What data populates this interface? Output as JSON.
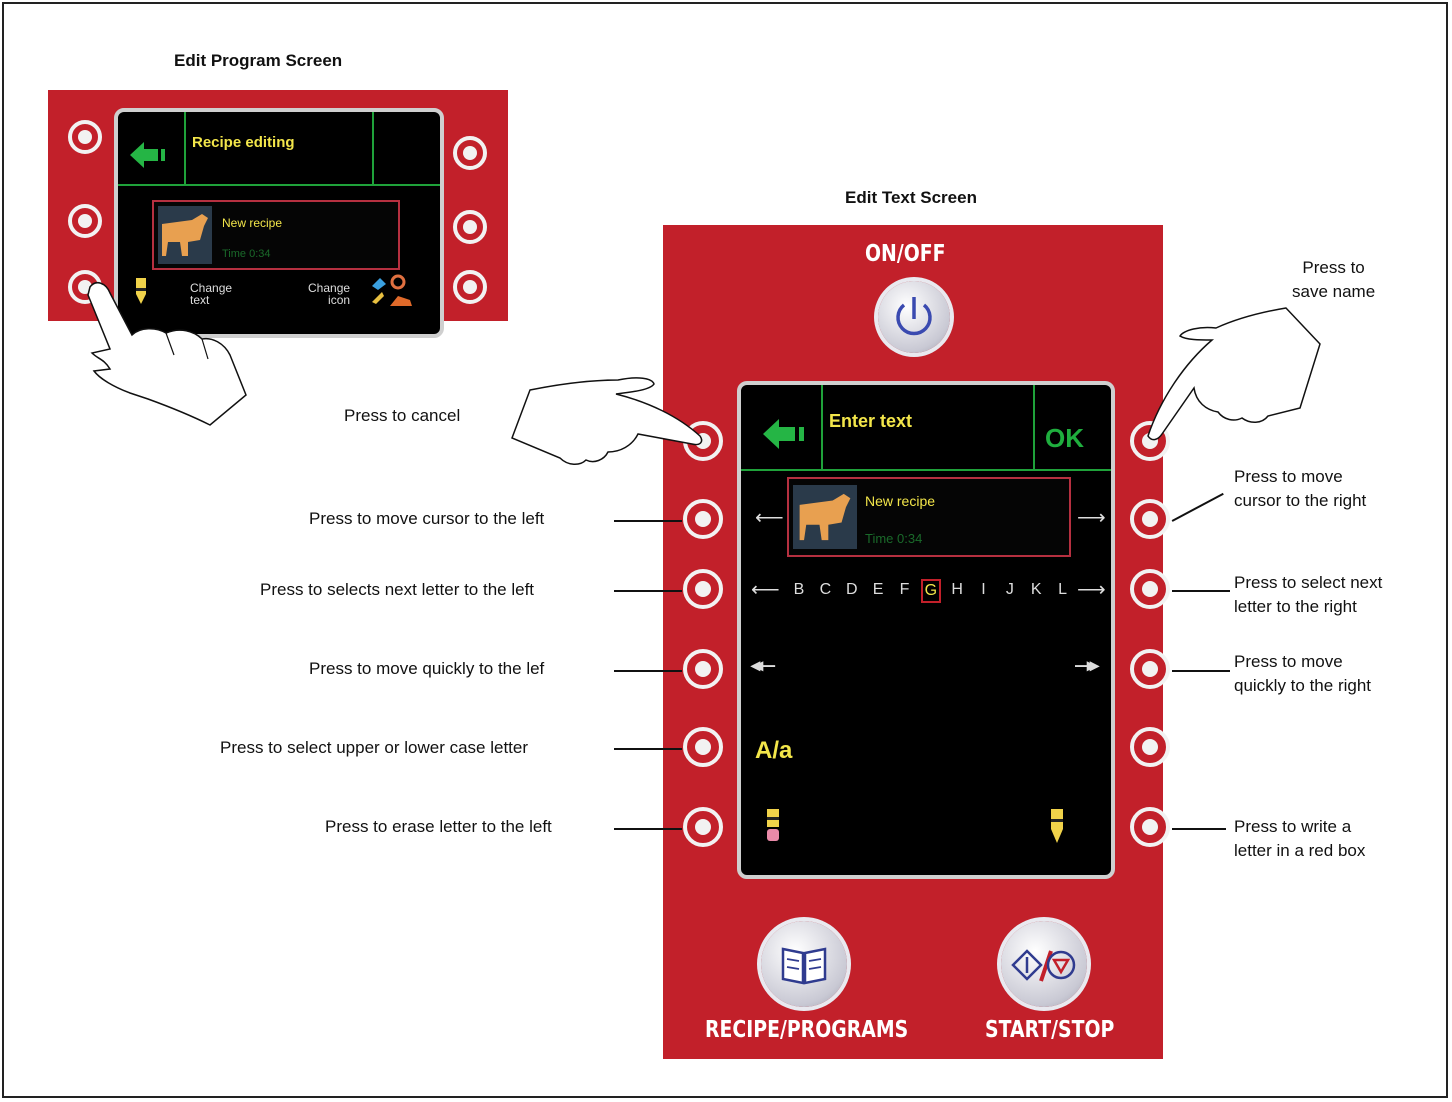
{
  "titles": {
    "edit_program": "Edit Program Screen",
    "edit_text": "Edit Text Screen"
  },
  "small_screen": {
    "header": "Recipe editing",
    "recipe_name": "New recipe",
    "recipe_time": "Time 0:34",
    "change_text": "Change\ntext",
    "change_icon": "Change\nicon"
  },
  "main_panel": {
    "on_off": "ON/OFF",
    "screen_header": "Enter text",
    "ok": "OK",
    "recipe_name": "New recipe",
    "recipe_time": "Time 0:34",
    "letters": [
      "B",
      "C",
      "D",
      "E",
      "F",
      "G",
      "H",
      "I",
      "J",
      "K",
      "L"
    ],
    "selected_letter": "G",
    "case_toggle": "A/a",
    "recipe_programs": "RECIPE/PROGRAMS",
    "start_stop": "START/STOP"
  },
  "callouts": {
    "cancel": "Press to cancel",
    "save_name": "Press to\nsave name",
    "cursor_left": "Press to move cursor to the left",
    "cursor_right": "Press to move\ncursor to the right",
    "letter_left": "Press to selects next letter to the left",
    "letter_right": "Press to select next\nletter to the right",
    "quick_left": "Press to move quickly to the lef",
    "quick_right": "Press to move\nquickly to the right",
    "case": "Press to select upper or lower case letter",
    "erase": "Press to erase letter to the left",
    "write": "Press to write a\nletter in a red box"
  },
  "colors": {
    "panel_red": "#c2202a",
    "screen_green": "#1fa23a",
    "screen_yellow": "#f3e64a",
    "ok_green": "#1fae3e"
  }
}
